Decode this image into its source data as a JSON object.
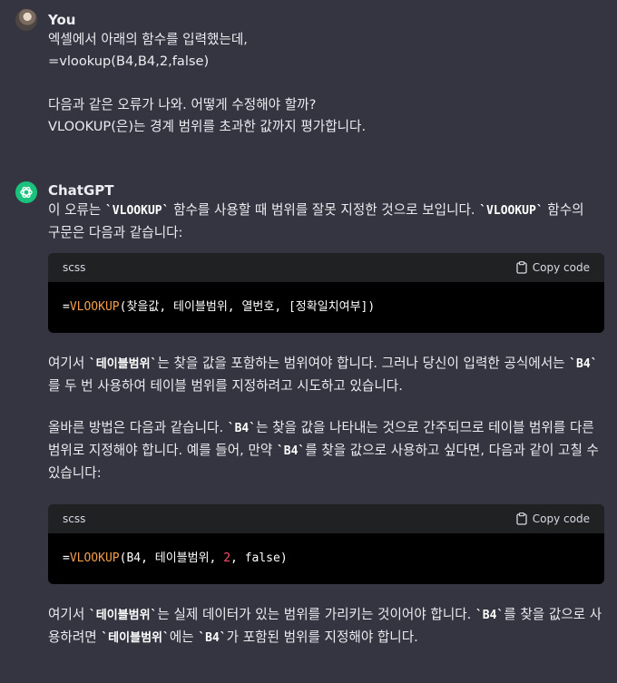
{
  "user": {
    "name": "You",
    "line1": "엑셀에서 아래의 함수를 입력했는데,",
    "line2": "=vlookup(B4,B4,2,false)",
    "line3": "다음과 같은 오류가 나와. 어떻게 수정해야 할까?",
    "line4": "VLOOKUP(은)는 경계 범위를 초과한 값까지 평가합니다."
  },
  "assistant": {
    "name": "ChatGPT",
    "p1": {
      "t1": "이 오류는 ",
      "c1": "`VLOOKUP`",
      "t2": " 함수를 사용할 때 범위를 잘못 지정한 것으로 보입니다. ",
      "c2": "`VLOOKUP`",
      "t3": " 함수의",
      "t4": "구문은 다음과 같습니다:"
    },
    "code1": {
      "lang": "scss",
      "copy": "Copy code",
      "prefix": "=",
      "fn": "VLOOKUP",
      "rest": "(찾을값, 테이블범위, 열번호, [정확일치여부])"
    },
    "p2": {
      "t1": "여기서 ",
      "c1": "`테이블범위`",
      "t2": "는 찾을 값을 포함하는 범위여야 합니다. 그러나 당신이 입력한 공식에서는 ",
      "c2": "`B4`",
      "t3": "를 두 번 사용하여 테이블 범위를 지정하려고 시도하고 있습니다."
    },
    "p3": {
      "t1": "올바른 방법은 다음과 같습니다. ",
      "c1": "`B4`",
      "t2": "는 찾을 값을 나타내는 것으로 간주되므로 테이블 범위를 다른",
      "t3": "범위로 지정해야 합니다. 예를 들어, 만약 ",
      "c2": "`B4`",
      "t4": "를 찾을 값으로 사용하고 싶다면, 다음과 같이 고칠 수",
      "t5": "있습니다:"
    },
    "code2": {
      "lang": "scss",
      "copy": "Copy code",
      "prefix": "=",
      "fn": "VLOOKUP",
      "mid": "(B4, 테이블범위, ",
      "num": "2",
      "end": ", false)"
    },
    "p4": {
      "t1": "여기서 ",
      "c1": "`테이블범위`",
      "t2": "는 실제 데이터가 있는 범위를 가리키는 것이어야 합니다. ",
      "c2": "`B4`",
      "t3": "를 찾을 값으로 사",
      "t4": "용하려면 ",
      "c3": "`테이블범위`",
      "t5": "에는 ",
      "c4": "`B4`",
      "t6": "가 포함된 범위를 지정해야 합니다."
    }
  },
  "colors": {
    "background": "#343541",
    "text": "#ececf1",
    "code_bg": "#000000",
    "code_header_bg": "#202123",
    "function_color": "#f29d49",
    "number_color": "#ff4a6b",
    "bot_avatar": "#19c37d"
  }
}
